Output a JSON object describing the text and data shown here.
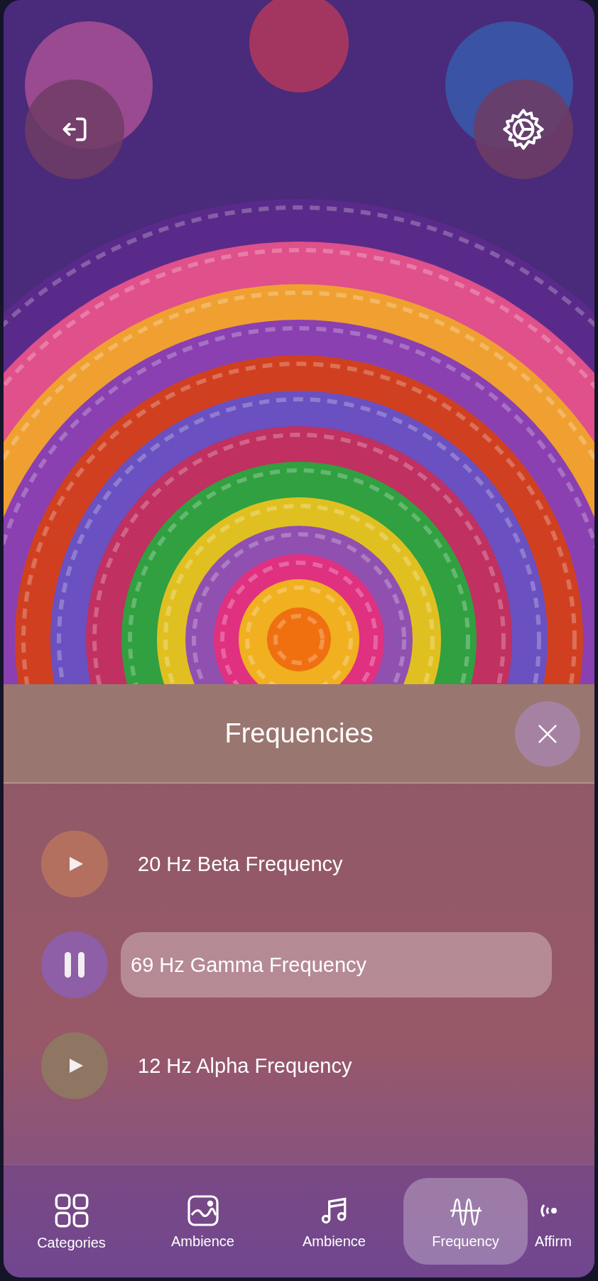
{
  "panel": {
    "title": "Frequencies"
  },
  "tracks": [
    {
      "title": "20 Hz Beta Frequency",
      "playing": false,
      "color": "#b8735e"
    },
    {
      "title": "69 Hz Gamma Frequency",
      "playing": true,
      "color": "#8e5fae"
    },
    {
      "title": "12 Hz Alpha Frequency",
      "playing": false,
      "color": "#8f7a62"
    }
  ],
  "nav": [
    {
      "kind": "grid",
      "label": "Categories",
      "selected": false
    },
    {
      "kind": "image",
      "label": "Ambience",
      "selected": false
    },
    {
      "kind": "music",
      "label": "Ambience",
      "selected": false
    },
    {
      "kind": "wave",
      "label": "Frequency",
      "selected": true
    },
    {
      "kind": "broadcast",
      "label": "Affirm",
      "selected": false
    }
  ]
}
